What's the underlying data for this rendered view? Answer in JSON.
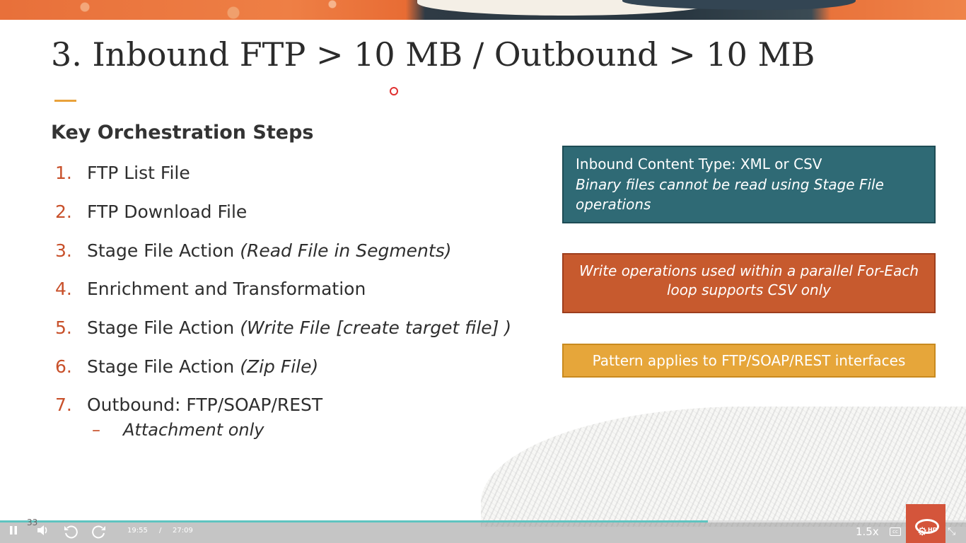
{
  "slide": {
    "title": "3. Inbound FTP > 10 MB / Outbound > 10 MB",
    "section_heading": "Key Orchestration Steps",
    "steps": [
      {
        "num": "1.",
        "text": "FTP List File",
        "note": ""
      },
      {
        "num": "2.",
        "text": "FTP Download File",
        "note": ""
      },
      {
        "num": "3.",
        "text": "Stage File Action ",
        "note": "(Read File in Segments)"
      },
      {
        "num": "4.",
        "text": "Enrichment and Transformation",
        "note": ""
      },
      {
        "num": "5.",
        "text": "Stage File Action ",
        "note": "(Write File [create target file] )"
      },
      {
        "num": "6.",
        "text": "Stage File Action ",
        "note": "(Zip File)"
      },
      {
        "num": "7.",
        "text": "Outbound: FTP/SOAP/REST",
        "note": ""
      }
    ],
    "sub_item": {
      "dash": "–",
      "text": "Attachment only"
    },
    "boxes": {
      "teal": {
        "line1": "Inbound Content Type: XML or CSV",
        "line2": "Binary files cannot be read using Stage File operations",
        "color": "#2f6a75"
      },
      "orange": {
        "text": "Write operations used within a parallel For-Each loop supports CSV only",
        "color": "#c75a2e"
      },
      "gold": {
        "text": "Pattern applies to FTP/SOAP/REST interfaces",
        "color": "#e6a63a"
      }
    },
    "page_number": "33",
    "accent_color": "#e9a23b",
    "number_color": "#c8502a"
  },
  "player": {
    "current_time": "19:55",
    "separator": "/",
    "duration": "27:09",
    "progress_fraction": 0.733,
    "speed": "1.5x",
    "hd_label": "HD",
    "icons": {
      "pause": "pause-icon",
      "volume": "volume-icon",
      "rewind": "rewind-icon",
      "forward": "forward-icon",
      "captions": "captions-icon",
      "settings": "gear-icon",
      "fullscreen": "fullscreen-exit-icon"
    }
  }
}
